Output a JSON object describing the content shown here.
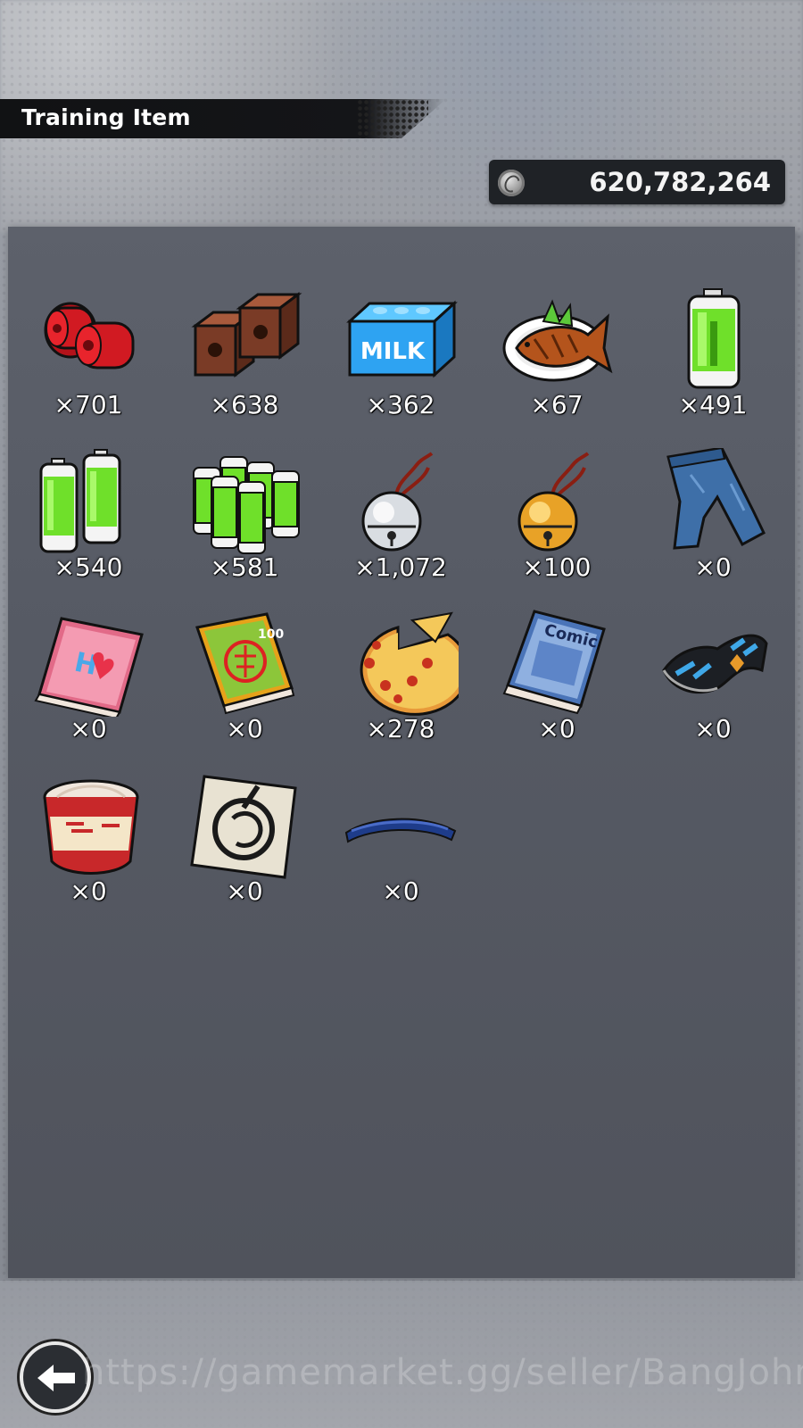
{
  "header": {
    "title": "Training Item"
  },
  "currency": {
    "icon": "coin-icon",
    "value": "620,782,264"
  },
  "items": [
    {
      "name": "red-weights",
      "count": "×701"
    },
    {
      "name": "brick-blocks",
      "count": "×638"
    },
    {
      "name": "milk-carton",
      "count": "×362",
      "label": "MILK"
    },
    {
      "name": "grilled-fish",
      "count": "×67"
    },
    {
      "name": "battery-single",
      "count": "×491"
    },
    {
      "name": "battery-double",
      "count": "×540"
    },
    {
      "name": "battery-pack",
      "count": "×581"
    },
    {
      "name": "silver-bell",
      "count": "×1,072"
    },
    {
      "name": "gold-bell",
      "count": "×100"
    },
    {
      "name": "jeans",
      "count": "×0"
    },
    {
      "name": "pink-book",
      "count": "×0"
    },
    {
      "name": "orange-book",
      "count": "×0",
      "label": "100"
    },
    {
      "name": "pizza",
      "count": "×278"
    },
    {
      "name": "comic-book",
      "count": "×0",
      "label": "Comic"
    },
    {
      "name": "wristband",
      "count": "×0"
    },
    {
      "name": "cup-noodle",
      "count": "×0"
    },
    {
      "name": "emblem-card",
      "count": "×0"
    },
    {
      "name": "blue-headband",
      "count": "×0"
    }
  ],
  "footer": {
    "back_icon": "back-arrow-icon",
    "watermark": "https://gamemarket.gg/seller/BangJohn"
  },
  "colors": {
    "panel": "#565a64",
    "title_bar": "#141518",
    "currency_box": "#1f2226",
    "battery_green": "#6fe02a"
  }
}
